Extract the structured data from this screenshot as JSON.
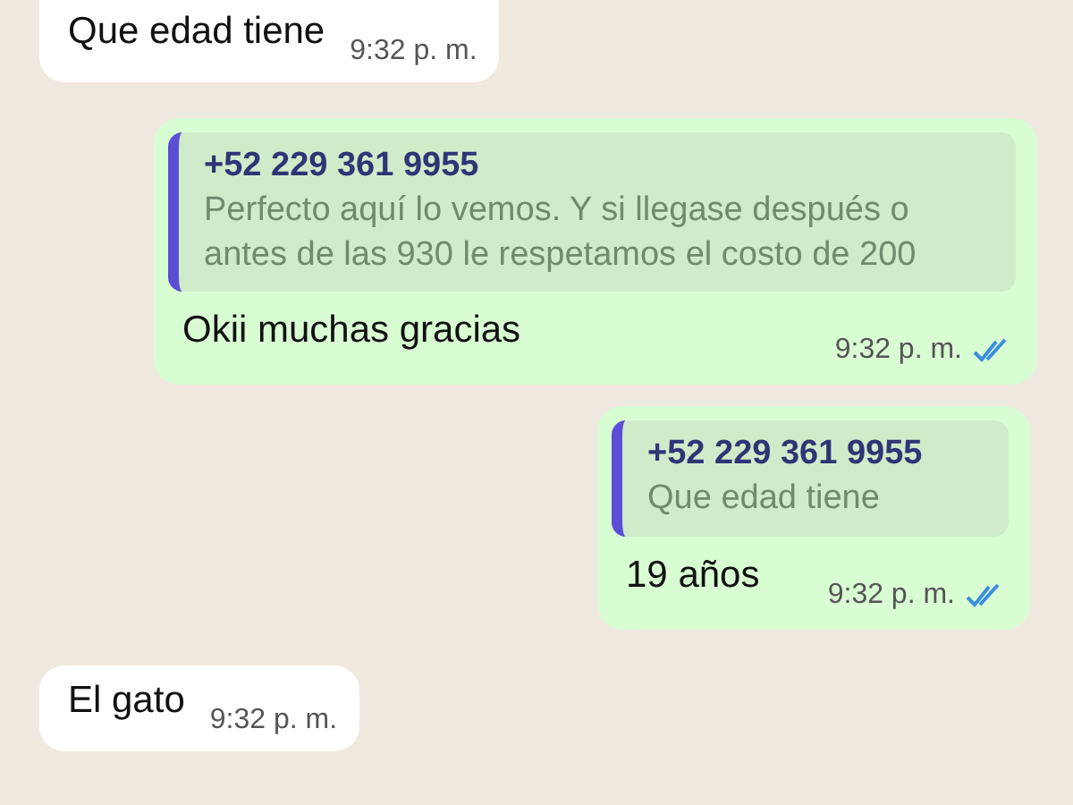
{
  "messages": [
    {
      "kind": "incoming",
      "text": "Que edad tiene",
      "time": "9:32 p. m."
    },
    {
      "kind": "outgoing",
      "quote": {
        "author": "+52 229 361 9955",
        "text": "Perfecto aquí lo vemos. Y si llegase después o antes de las 930 le respetamos el costo de 200"
      },
      "text": "Okii muchas gracias",
      "time": "9:32 p. m.",
      "read": true
    },
    {
      "kind": "outgoing",
      "quote": {
        "author": "+52 229 361 9955",
        "text": "Que edad tiene"
      },
      "text": "19 años",
      "time": "9:32 p. m.",
      "read": true
    },
    {
      "kind": "incoming",
      "text": "El gato",
      "time": "9:32 p. m."
    }
  ]
}
